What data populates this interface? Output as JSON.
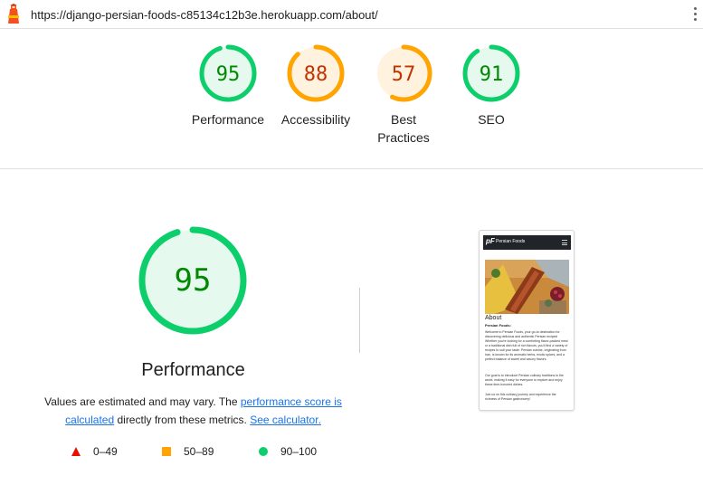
{
  "browser": {
    "url": "https://django-persian-foods-c85134c12b3e.herokuapp.com/about/"
  },
  "colors": {
    "pass": "#0cce6b",
    "pass_text": "#008800",
    "pass_bg": "#e6f9ef",
    "average": "#ffa400",
    "average_text": "#c33300",
    "average_bg": "#fff3e0",
    "fail": "#eb0f00",
    "link": "#1a73e8"
  },
  "summary": {
    "gauges": [
      {
        "score": "95",
        "label": "Performance",
        "rating": "pass"
      },
      {
        "score": "88",
        "label": "Accessibility",
        "rating": "average"
      },
      {
        "score": "57",
        "label": "Best Practices",
        "rating": "average"
      },
      {
        "score": "91",
        "label": "SEO",
        "rating": "pass"
      }
    ]
  },
  "performance": {
    "score": "95",
    "title": "Performance",
    "desc_part1": "Values are estimated and may vary. The ",
    "link_score": "performance score is calculated",
    "desc_part2": " directly from these metrics. ",
    "link_calculator": "See calculator."
  },
  "legend": {
    "fail": "0–49",
    "average": "50–89",
    "pass": "90–100"
  },
  "thumbnail": {
    "brand": "Persian Foods",
    "logo": "pF",
    "heading": "About",
    "subheading": "Persian Foods:",
    "p1": "Welcome to Persian Foods, your go-to destination for discovering delicious and authentic Persian recipes! Whether you're looking for a comforting flavor-packed meal or a traditional dish full of rich flavors, you'll find a variety of recipes to suit your taste. Persian cuisine, originating from Iran, is known for its aromatic herbs, exotic spices, and a perfect balance of sweet and savory flavors.",
    "p2": "Our goal is to introduce Persian culinary traditions to the world, making it easy for everyone to explore and enjoy these time-honored dishes.",
    "p3": "Join us on this culinary journey and experience the richness of Persian gastronomy!"
  }
}
